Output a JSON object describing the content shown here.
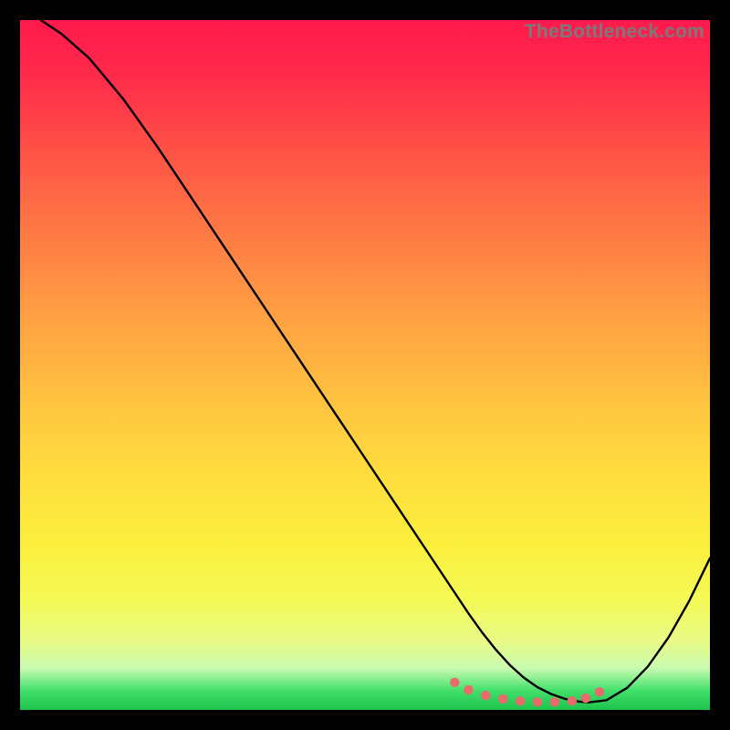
{
  "watermark": "TheBottleneck.com",
  "chart_data": {
    "type": "line",
    "title": "",
    "xlabel": "",
    "ylabel": "",
    "xlim": [
      0,
      100
    ],
    "ylim": [
      0,
      100
    ],
    "series": [
      {
        "name": "curve",
        "x": [
          3,
          6,
          10,
          15,
          20,
          25,
          30,
          35,
          40,
          45,
          50,
          55,
          60,
          63,
          65,
          67,
          69,
          71,
          73,
          75,
          77,
          79,
          81,
          82.5,
          85,
          88,
          91,
          94,
          97,
          100
        ],
        "y": [
          100,
          98,
          94.5,
          88.5,
          81.5,
          74,
          66.5,
          59,
          51.5,
          44,
          36.5,
          29,
          21.5,
          17,
          14,
          11.2,
          8.7,
          6.5,
          4.7,
          3.3,
          2.3,
          1.6,
          1.2,
          1.1,
          1.4,
          3.2,
          6.3,
          10.5,
          15.8,
          22
        ]
      }
    ],
    "markers": {
      "name": "bottom-markers",
      "x": [
        63,
        65,
        67.5,
        70,
        72.5,
        75,
        77.5,
        80,
        82,
        84
      ],
      "y": [
        4.0,
        2.9,
        2.1,
        1.6,
        1.3,
        1.15,
        1.15,
        1.3,
        1.7,
        2.6
      ]
    },
    "colors": {
      "gradient_top": "#ff1a4d",
      "gradient_mid": "#ffdd3e",
      "gradient_bottom": "#1dc24e",
      "curve": "#000000",
      "markers": "#e86a6a",
      "background": "#000000"
    }
  }
}
